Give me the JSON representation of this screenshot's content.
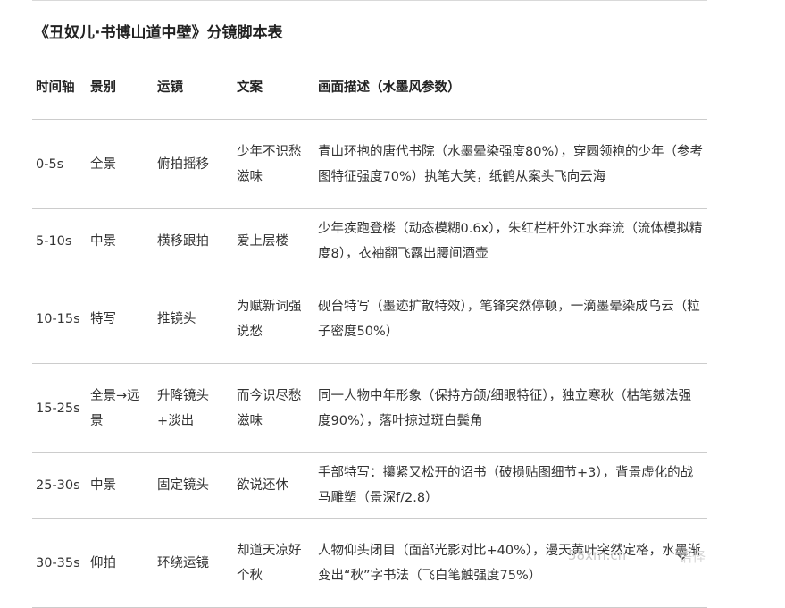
{
  "document": {
    "title": "《丑奴儿·书博山道中壁》分镜脚本表"
  },
  "table": {
    "headers": {
      "time": "时间轴",
      "shot": "景别",
      "camera": "运镜",
      "copy": "文案",
      "description": "画面描述（水墨风参数）"
    },
    "rows": [
      {
        "time": "0-5s",
        "shot": "全景",
        "camera": "俯拍摇移",
        "copy": "少年不识愁滋味",
        "description": "青山环抱的唐代书院（水墨晕染强度80%），穿圆领袍的少年（参考图特征强度70%）执笔大笑，纸鹤从案头飞向云海"
      },
      {
        "time": "5-10s",
        "shot": "中景",
        "camera": "横移跟拍",
        "copy": "爱上层楼",
        "description": "少年疾跑登楼（动态模糊0.6x），朱红栏杆外江水奔流（流体模拟精度8），衣袖翻飞露出腰间酒壶"
      },
      {
        "time": "10-15s",
        "shot": "特写",
        "camera": "推镜头",
        "copy": "为赋新词强说愁",
        "description": "砚台特写（墨迹扩散特效），笔锋突然停顿，一滴墨晕染成乌云（粒子密度50%）"
      },
      {
        "time": "15-25s",
        "shot": "全景→远景",
        "camera": "升降镜头+淡出",
        "copy": "而今识尽愁滋味",
        "description": "同一人物中年形象（保持方颌/细眼特征），独立寒秋（枯笔皴法强度90%），落叶掠过斑白鬓角"
      },
      {
        "time": "25-30s",
        "shot": "中景",
        "camera": "固定镜头",
        "copy": "欲说还休",
        "description": "手部特写：攥紧又松开的诏书（破损贴图细节+3），背景虚化的战马雕塑（景深f/2.8）"
      },
      {
        "time": "30-35s",
        "shot": "仰拍",
        "camera": "环绕运镜",
        "copy": "却道天凉好个秋",
        "description": "人物仰头闭目（面部光影对比+40%），漫天黄叶突然定格，水墨渐变出“秋”字书法（飞白笔触强度75%）"
      }
    ]
  },
  "overlay": {
    "watermark": "58xm.cn",
    "watermark_right": "语怪",
    "collapse_icon": "chevron-down-icon"
  }
}
